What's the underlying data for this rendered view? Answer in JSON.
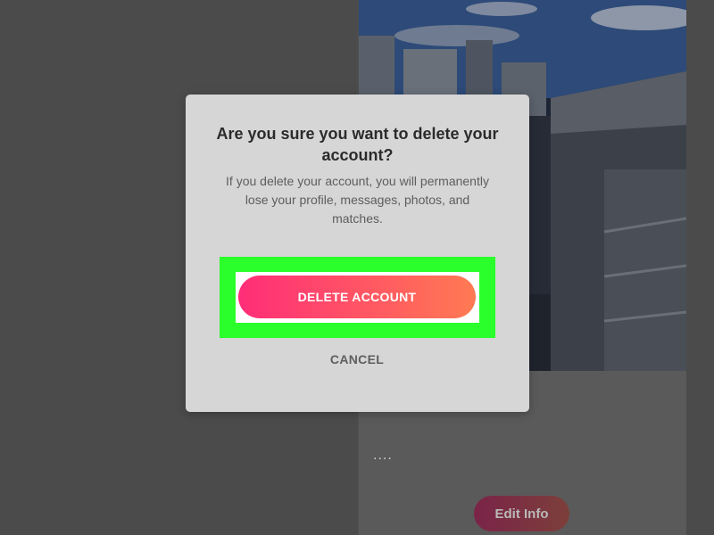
{
  "dialog": {
    "title": "Are you sure you want to delete your account?",
    "body": "If you delete your account, you will permanently lose your profile, messages, photos, and matches.",
    "delete_label": "DELETE ACCOUNT",
    "cancel_label": "CANCEL"
  },
  "background": {
    "ellipsis": "....",
    "edit_info_label": "Edit Info"
  },
  "colors": {
    "highlight": "#2bff2b",
    "delete_gradient_start": "#ff2d78",
    "delete_gradient_end": "#ff7a52",
    "overlay_gray": "#4d4d4d"
  }
}
